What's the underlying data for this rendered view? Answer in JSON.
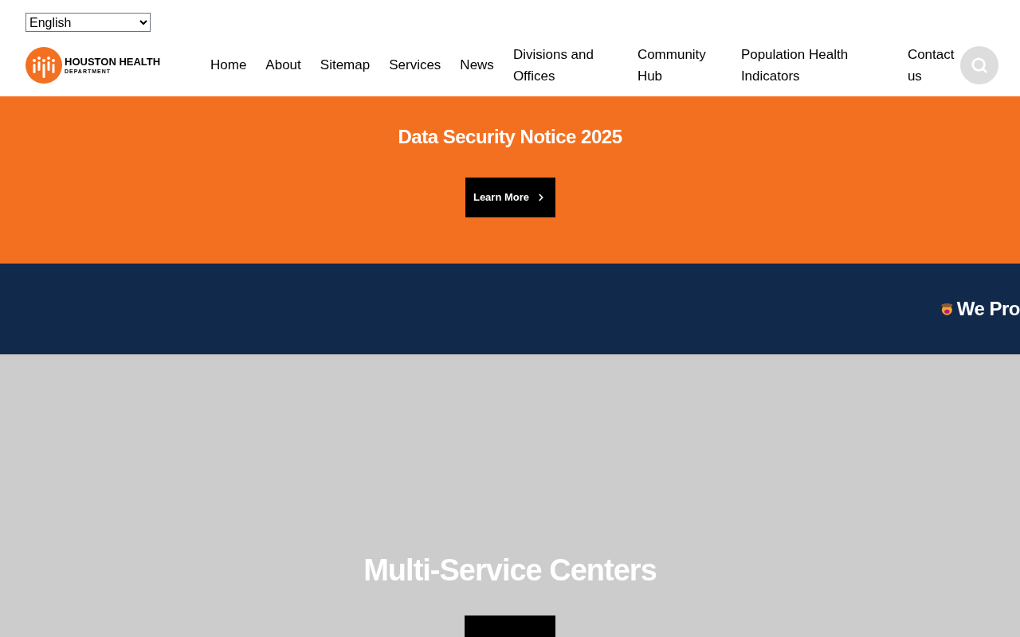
{
  "language_select": {
    "value": "English"
  },
  "logo": {
    "title": "HOUSTON HEALTH",
    "subtitle": "DEPARTMENT"
  },
  "nav": [
    {
      "label": "Home"
    },
    {
      "label": "About"
    },
    {
      "label": "Sitemap"
    },
    {
      "label": "Services"
    },
    {
      "label": "News"
    },
    {
      "label": "Divisions and Offices"
    },
    {
      "label": "Community Hub"
    },
    {
      "label": "Population Health Indicators"
    },
    {
      "label": "Contact us"
    }
  ],
  "notice": {
    "title": "Data Security Notice 2025",
    "button": "Learn More"
  },
  "ticker": {
    "text": "We Pro"
  },
  "hero": {
    "title": "Multi-Service Centers"
  }
}
